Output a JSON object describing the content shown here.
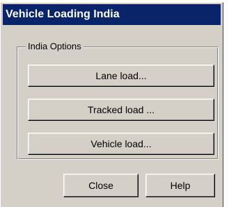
{
  "window": {
    "title": "Vehicle Loading India"
  },
  "group": {
    "label": "India Options",
    "buttons": {
      "lane": "Lane load...",
      "tracked": "Tracked load ...",
      "vehicle": "Vehicle load..."
    }
  },
  "footer": {
    "close": "Close",
    "help": "Help"
  }
}
